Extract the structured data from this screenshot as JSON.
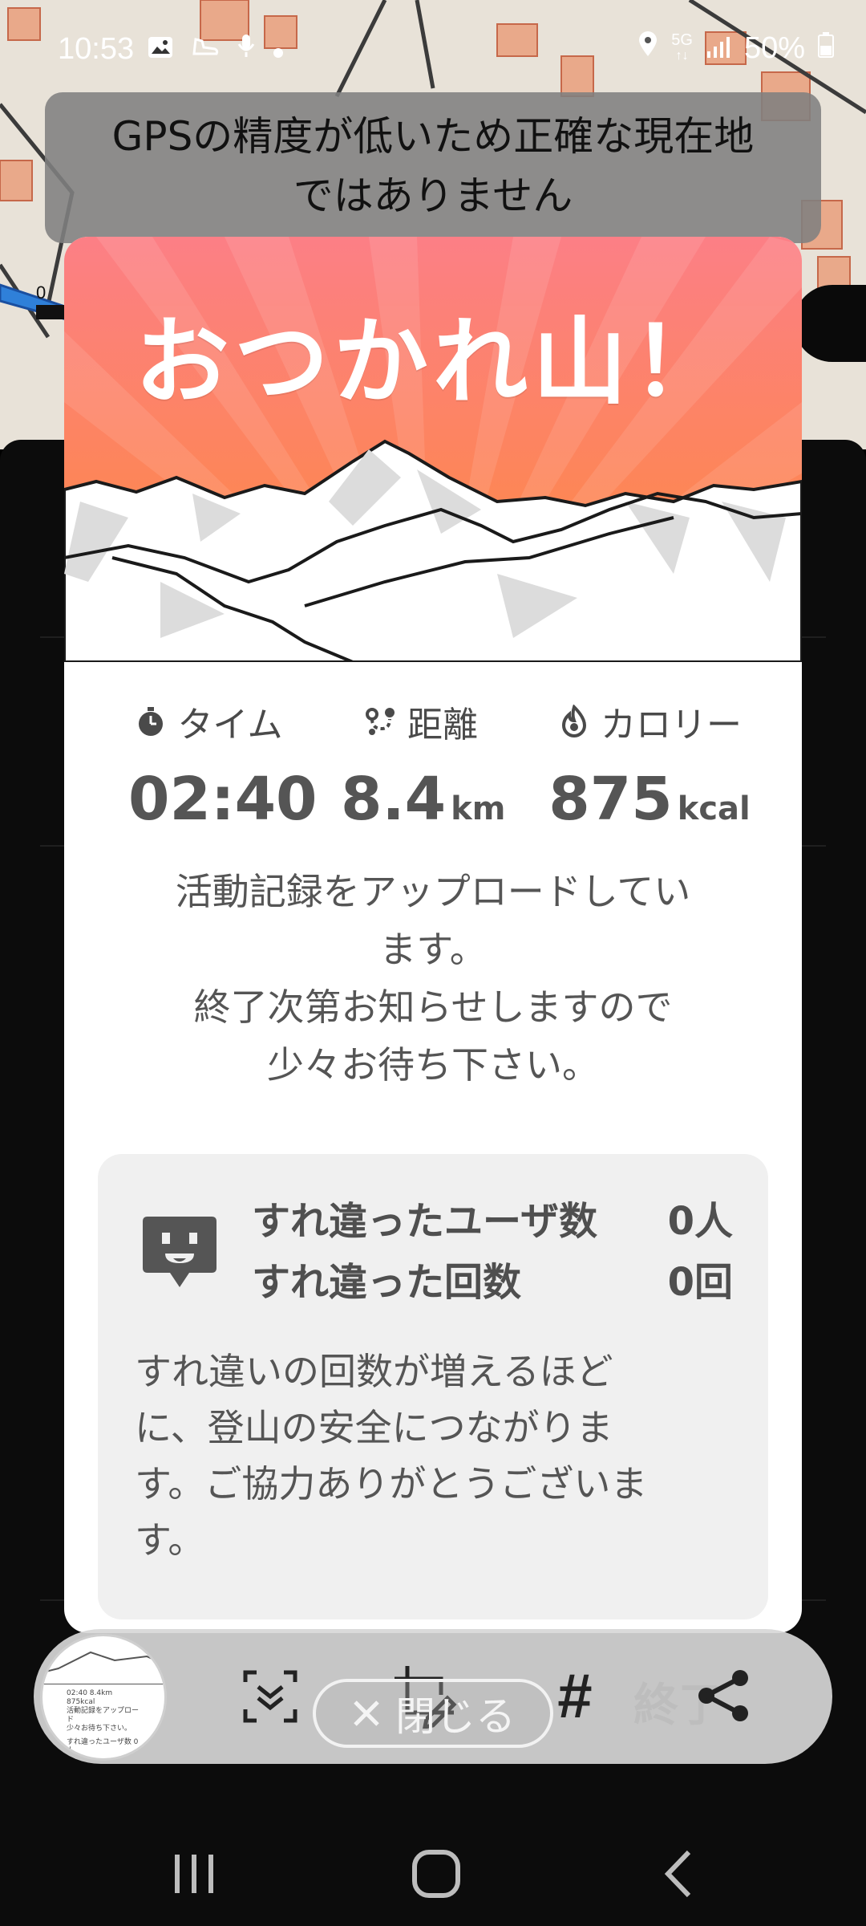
{
  "status_bar": {
    "time": "10:53",
    "network": "5G",
    "battery": "50%",
    "left_icons": [
      "image-icon",
      "shoe-icon",
      "mic-icon",
      "dot-icon"
    ],
    "right_icons": [
      "location-icon",
      "network-5g-icon",
      "signal-icon",
      "battery-icon"
    ]
  },
  "gps_notice": {
    "line1": "GPSの精度が低いため正確な現在地",
    "line2": "ではありません"
  },
  "modal": {
    "title": "おつかれ山！",
    "stats": [
      {
        "label": "タイム",
        "value": "02:40",
        "unit": "",
        "icon": "stopwatch-icon"
      },
      {
        "label": "距離",
        "value": "8.4",
        "unit": "km",
        "icon": "route-icon"
      },
      {
        "label": "カロリー",
        "value": "875",
        "unit": "kcal",
        "icon": "flame-icon"
      }
    ],
    "upload_message": {
      "line1": "活動記録をアップロードしてい",
      "line2": "ます。",
      "line3": "終了次第お知らせしますので",
      "line4": "少々お待ち下さい。"
    },
    "encounter": {
      "users_label": "すれ違ったユーザ数",
      "users_value": "0人",
      "count_label": "すれ違った回数",
      "count_value": "0回",
      "desc_line1": "すれ違いの回数が増えるほど",
      "desc_line2": "に、登山の安全につながりま",
      "desc_line3": "す。ご協力ありがとうございま",
      "desc_line4": "す。"
    }
  },
  "screenshot_toolbar": {
    "hash_label": "#",
    "ghost_end_label": "終了",
    "close_label": "閉じる"
  },
  "colors": {
    "hero_top": "#fc7f86",
    "hero_bottom": "#fd8a3e",
    "card_bg": "#f0f0f0"
  }
}
